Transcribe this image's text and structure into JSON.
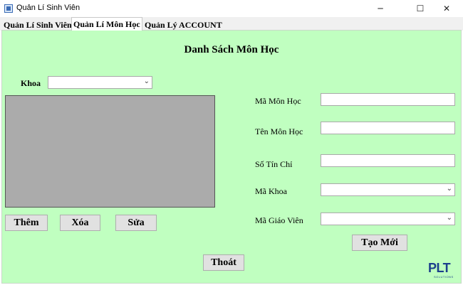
{
  "window": {
    "title": "Quản Lí Sinh Viên",
    "minimize_glyph": "─",
    "maximize_glyph": "☐",
    "close_glyph": "✕"
  },
  "tabs": [
    {
      "label": "Quản Lí Sinh Viên",
      "active": false
    },
    {
      "label": "Quản Lí Môn Học",
      "active": true
    },
    {
      "label": "Quản Lý ACCOUNT",
      "active": false
    }
  ],
  "form": {
    "heading": "Danh Sách Môn Học",
    "khoa_label": "Khoa",
    "khoa_value": "",
    "fields": {
      "ma_mon_hoc_label": "Mã Môn Học",
      "ma_mon_hoc_value": "",
      "ten_mon_hoc_label": "Tên Môn Học",
      "ten_mon_hoc_value": "",
      "so_tin_chi_label": "Số Tín Chỉ",
      "so_tin_chi_value": "",
      "ma_khoa_label": "Mã Khoa",
      "ma_khoa_value": "",
      "ma_giao_vien_label": "Mã Giáo Viên",
      "ma_giao_vien_value": ""
    },
    "caret_glyph": "⌄"
  },
  "buttons": {
    "them": "Thêm",
    "xoa": "Xóa",
    "sua": "Sửa",
    "tao_moi": "Tạo Mới",
    "thoat": "Thoát"
  },
  "logo": {
    "text": "PLT",
    "subtext": "SOLUTIONS"
  },
  "colors": {
    "panel_background": "#c0ffc0",
    "grid_background": "#ababab",
    "button_background": "#e1e1e1",
    "logo": "#1c3f8c"
  }
}
